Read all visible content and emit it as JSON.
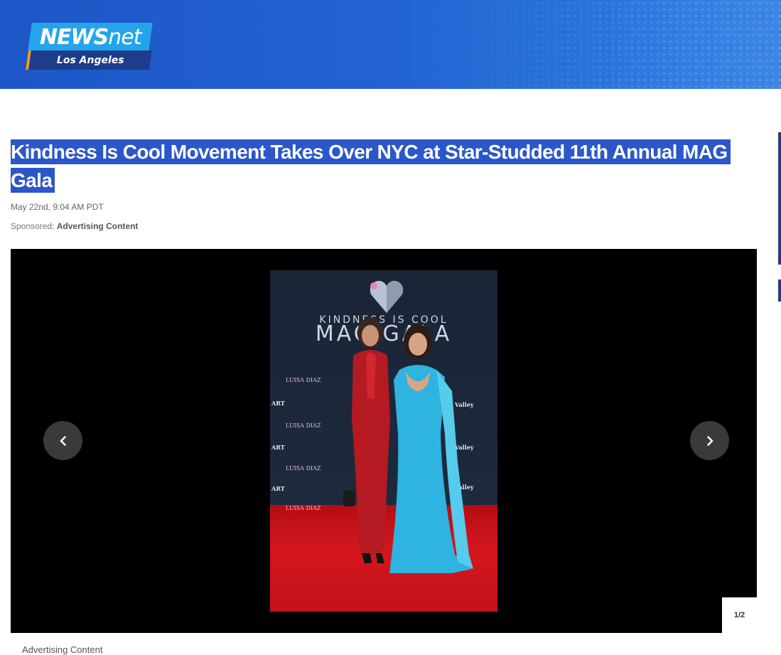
{
  "header": {
    "logo_top": "NEWS",
    "logo_top_suffix": "net",
    "logo_bottom": "Los Angeles"
  },
  "article": {
    "title": "Kindness Is Cool Movement Takes Over NYC at Star-Studded 11th Annual MAG Gala",
    "date": "May 22nd, 9:04 AM PDT",
    "sponsored_label": "Sponsored:",
    "sponsored_value": "Advertising Content"
  },
  "gallery": {
    "photo_text_1": "KINDNESS IS COOL",
    "photo_text_2": "MAG GALA",
    "photo_logo": "LUISA DIAZ",
    "photo_sponsor": "Valley",
    "counter": "1/2",
    "prev_icon": "chevron-left-icon",
    "next_icon": "chevron-right-icon",
    "caption": "Advertising Content"
  },
  "colors": {
    "header_blue": "#2263d1",
    "logo_cyan": "#24a4ea",
    "logo_navy": "#1e3c8c",
    "highlight": "#2b57c9"
  }
}
